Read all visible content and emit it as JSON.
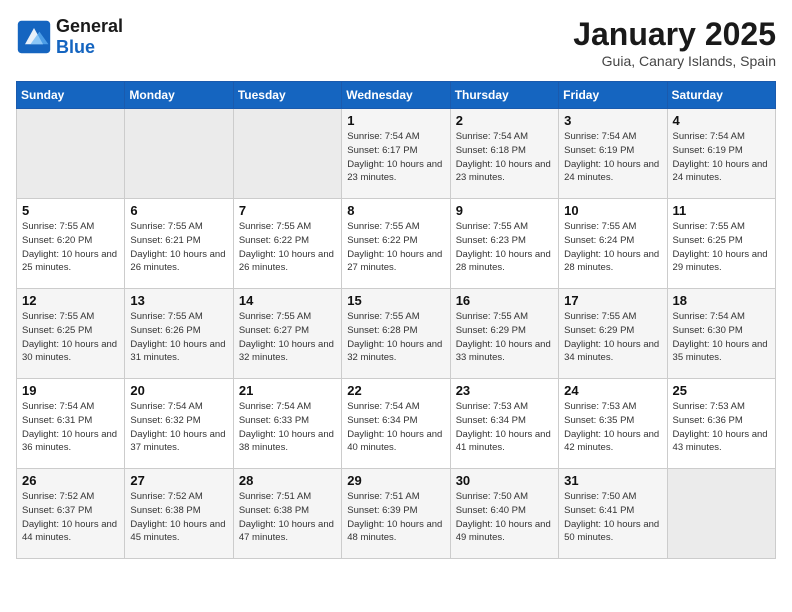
{
  "header": {
    "logo_line1": "General",
    "logo_line2": "Blue",
    "month_title": "January 2025",
    "location": "Guia, Canary Islands, Spain"
  },
  "weekdays": [
    "Sunday",
    "Monday",
    "Tuesday",
    "Wednesday",
    "Thursday",
    "Friday",
    "Saturday"
  ],
  "weeks": [
    [
      {
        "day": "",
        "sunrise": "",
        "sunset": "",
        "daylight": "",
        "empty": true
      },
      {
        "day": "",
        "sunrise": "",
        "sunset": "",
        "daylight": "",
        "empty": true
      },
      {
        "day": "",
        "sunrise": "",
        "sunset": "",
        "daylight": "",
        "empty": true
      },
      {
        "day": "1",
        "sunrise": "Sunrise: 7:54 AM",
        "sunset": "Sunset: 6:17 PM",
        "daylight": "Daylight: 10 hours and 23 minutes."
      },
      {
        "day": "2",
        "sunrise": "Sunrise: 7:54 AM",
        "sunset": "Sunset: 6:18 PM",
        "daylight": "Daylight: 10 hours and 23 minutes."
      },
      {
        "day": "3",
        "sunrise": "Sunrise: 7:54 AM",
        "sunset": "Sunset: 6:19 PM",
        "daylight": "Daylight: 10 hours and 24 minutes."
      },
      {
        "day": "4",
        "sunrise": "Sunrise: 7:54 AM",
        "sunset": "Sunset: 6:19 PM",
        "daylight": "Daylight: 10 hours and 24 minutes."
      }
    ],
    [
      {
        "day": "5",
        "sunrise": "Sunrise: 7:55 AM",
        "sunset": "Sunset: 6:20 PM",
        "daylight": "Daylight: 10 hours and 25 minutes."
      },
      {
        "day": "6",
        "sunrise": "Sunrise: 7:55 AM",
        "sunset": "Sunset: 6:21 PM",
        "daylight": "Daylight: 10 hours and 26 minutes."
      },
      {
        "day": "7",
        "sunrise": "Sunrise: 7:55 AM",
        "sunset": "Sunset: 6:22 PM",
        "daylight": "Daylight: 10 hours and 26 minutes."
      },
      {
        "day": "8",
        "sunrise": "Sunrise: 7:55 AM",
        "sunset": "Sunset: 6:22 PM",
        "daylight": "Daylight: 10 hours and 27 minutes."
      },
      {
        "day": "9",
        "sunrise": "Sunrise: 7:55 AM",
        "sunset": "Sunset: 6:23 PM",
        "daylight": "Daylight: 10 hours and 28 minutes."
      },
      {
        "day": "10",
        "sunrise": "Sunrise: 7:55 AM",
        "sunset": "Sunset: 6:24 PM",
        "daylight": "Daylight: 10 hours and 28 minutes."
      },
      {
        "day": "11",
        "sunrise": "Sunrise: 7:55 AM",
        "sunset": "Sunset: 6:25 PM",
        "daylight": "Daylight: 10 hours and 29 minutes."
      }
    ],
    [
      {
        "day": "12",
        "sunrise": "Sunrise: 7:55 AM",
        "sunset": "Sunset: 6:25 PM",
        "daylight": "Daylight: 10 hours and 30 minutes."
      },
      {
        "day": "13",
        "sunrise": "Sunrise: 7:55 AM",
        "sunset": "Sunset: 6:26 PM",
        "daylight": "Daylight: 10 hours and 31 minutes."
      },
      {
        "day": "14",
        "sunrise": "Sunrise: 7:55 AM",
        "sunset": "Sunset: 6:27 PM",
        "daylight": "Daylight: 10 hours and 32 minutes."
      },
      {
        "day": "15",
        "sunrise": "Sunrise: 7:55 AM",
        "sunset": "Sunset: 6:28 PM",
        "daylight": "Daylight: 10 hours and 32 minutes."
      },
      {
        "day": "16",
        "sunrise": "Sunrise: 7:55 AM",
        "sunset": "Sunset: 6:29 PM",
        "daylight": "Daylight: 10 hours and 33 minutes."
      },
      {
        "day": "17",
        "sunrise": "Sunrise: 7:55 AM",
        "sunset": "Sunset: 6:29 PM",
        "daylight": "Daylight: 10 hours and 34 minutes."
      },
      {
        "day": "18",
        "sunrise": "Sunrise: 7:54 AM",
        "sunset": "Sunset: 6:30 PM",
        "daylight": "Daylight: 10 hours and 35 minutes."
      }
    ],
    [
      {
        "day": "19",
        "sunrise": "Sunrise: 7:54 AM",
        "sunset": "Sunset: 6:31 PM",
        "daylight": "Daylight: 10 hours and 36 minutes."
      },
      {
        "day": "20",
        "sunrise": "Sunrise: 7:54 AM",
        "sunset": "Sunset: 6:32 PM",
        "daylight": "Daylight: 10 hours and 37 minutes."
      },
      {
        "day": "21",
        "sunrise": "Sunrise: 7:54 AM",
        "sunset": "Sunset: 6:33 PM",
        "daylight": "Daylight: 10 hours and 38 minutes."
      },
      {
        "day": "22",
        "sunrise": "Sunrise: 7:54 AM",
        "sunset": "Sunset: 6:34 PM",
        "daylight": "Daylight: 10 hours and 40 minutes."
      },
      {
        "day": "23",
        "sunrise": "Sunrise: 7:53 AM",
        "sunset": "Sunset: 6:34 PM",
        "daylight": "Daylight: 10 hours and 41 minutes."
      },
      {
        "day": "24",
        "sunrise": "Sunrise: 7:53 AM",
        "sunset": "Sunset: 6:35 PM",
        "daylight": "Daylight: 10 hours and 42 minutes."
      },
      {
        "day": "25",
        "sunrise": "Sunrise: 7:53 AM",
        "sunset": "Sunset: 6:36 PM",
        "daylight": "Daylight: 10 hours and 43 minutes."
      }
    ],
    [
      {
        "day": "26",
        "sunrise": "Sunrise: 7:52 AM",
        "sunset": "Sunset: 6:37 PM",
        "daylight": "Daylight: 10 hours and 44 minutes."
      },
      {
        "day": "27",
        "sunrise": "Sunrise: 7:52 AM",
        "sunset": "Sunset: 6:38 PM",
        "daylight": "Daylight: 10 hours and 45 minutes."
      },
      {
        "day": "28",
        "sunrise": "Sunrise: 7:51 AM",
        "sunset": "Sunset: 6:38 PM",
        "daylight": "Daylight: 10 hours and 47 minutes."
      },
      {
        "day": "29",
        "sunrise": "Sunrise: 7:51 AM",
        "sunset": "Sunset: 6:39 PM",
        "daylight": "Daylight: 10 hours and 48 minutes."
      },
      {
        "day": "30",
        "sunrise": "Sunrise: 7:50 AM",
        "sunset": "Sunset: 6:40 PM",
        "daylight": "Daylight: 10 hours and 49 minutes."
      },
      {
        "day": "31",
        "sunrise": "Sunrise: 7:50 AM",
        "sunset": "Sunset: 6:41 PM",
        "daylight": "Daylight: 10 hours and 50 minutes."
      },
      {
        "day": "",
        "sunrise": "",
        "sunset": "",
        "daylight": "",
        "empty": true
      }
    ]
  ]
}
